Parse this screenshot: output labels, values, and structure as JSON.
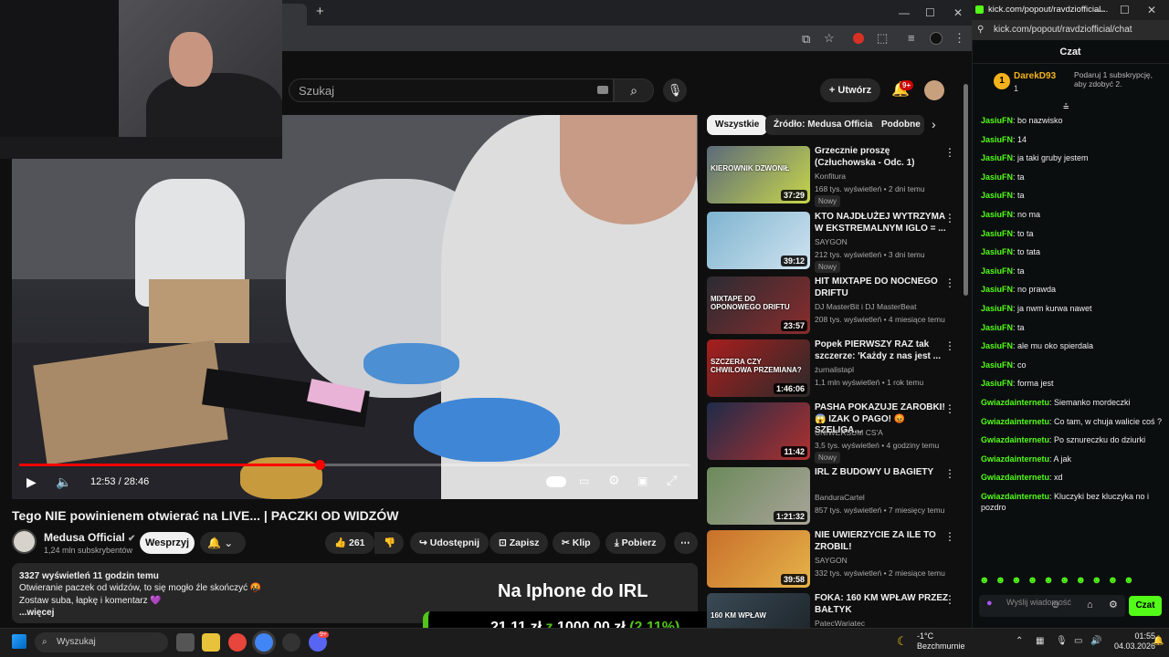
{
  "browser": {
    "new_tab": "+",
    "window_controls": [
      "—",
      "☐",
      "✕"
    ]
  },
  "youtube": {
    "search_placeholder": "Szukaj",
    "create_label": "Utwórz",
    "notif_count": "9+",
    "video": {
      "time": "12:53 / 28:46",
      "progress": 0.448,
      "title": "Tego NIE powinienem otwierać na LIVE... | PACZKI OD WIDZÓW",
      "channel": "Medusa Official",
      "subs": "1,24 mln subskrybentów",
      "support_label": "Wesprzyj",
      "likes": "261",
      "share_label": "Udostępnij",
      "save_label": "Zapisz",
      "clip_label": "Klip",
      "download_label": "Pobierz",
      "views_line": "3327 wyświetleń  11 godzin temu",
      "desc1": "Otwieranie paczek od widzów, to się mogło źle skończyć 🤬",
      "desc2": "Zostaw suba, łapkę i komentarz 💜",
      "more": "...więcej"
    },
    "overlay": {
      "line1": "Na Iphone do IRL",
      "amount": "21,11 zł",
      "z": "z",
      "goal": "1000,00 zł",
      "pct": "(2.11%)"
    },
    "chips": [
      "Wszystkie",
      "Źródło: Medusa Official",
      "Podobne"
    ],
    "recs": [
      {
        "title": "Grzecznie proszę (Człuchowska - Odc. 1)",
        "channel": "Konfitura",
        "meta": "168 tys. wyświetleń • 2 dni temu",
        "dur": "37:29",
        "new": "Nowy",
        "thumb_label": "KIEROWNIK DZWONIŁ",
        "c1": "#5b6a7a",
        "c2": "#c7d64a"
      },
      {
        "title": "KTO NAJDŁUŻEJ WYTRZYMA W EKSTREMALNYM IGLO = ...",
        "channel": "SAYGON",
        "meta": "212 tys. wyświetleń • 3 dni temu",
        "dur": "39:12",
        "new": "Nowy",
        "thumb_label": "",
        "c1": "#7fb4d0",
        "c2": "#cfe3ef"
      },
      {
        "title": "HIT MIXTAPE DO NOCNEGO DRIFTU",
        "channel": "DJ MasterBit i DJ MasterBeat",
        "meta": "208 tys. wyświetleń • 4 miesiące temu",
        "dur": "23:57",
        "new": "",
        "thumb_label": "MIXTAPE DO OPONOWEGO DRIFTU",
        "c1": "#2a2c33",
        "c2": "#8a2c2c"
      },
      {
        "title": "Popek PIERWSZY RAZ tak szczerze: 'Każdy z nas jest ...",
        "channel": "żurnalistapl",
        "meta": "1,1 mln wyświetleń • 1 rok temu",
        "dur": "1:46:06",
        "new": "",
        "thumb_label": "SZCZERA CZY CHWILOWA PRZEMIANA?",
        "c1": "#a81e1e",
        "c2": "#2a2a2a"
      },
      {
        "title": "PASHA POKAZUJE ZAROBKI! 😱 IZAK O PAGO! 😡 SZELIGA...",
        "channel": "UNIWERSUM CS'A",
        "meta": "3,5 tys. wyświetleń • 4 godziny temu",
        "dur": "11:42",
        "new": "Nowy",
        "thumb_label": "",
        "c1": "#1e2c4a",
        "c2": "#b0302e"
      },
      {
        "title": "IRL Z BUDOWY U BAGIETY",
        "channel": "BandurаCartel",
        "meta": "857 tys. wyświetleń • 7 miesięcy temu",
        "dur": "1:21:32",
        "new": "",
        "thumb_label": "",
        "c1": "#6b8a5a",
        "c2": "#a9a49a"
      },
      {
        "title": "NIE UWIERZYCIE ZA ILE TO ZROBIL!",
        "channel": "SAYGON",
        "meta": "332 tys. wyświetleń • 2 miesiące temu",
        "dur": "39:58",
        "new": "",
        "thumb_label": "",
        "c1": "#c8702a",
        "c2": "#e6b34a"
      },
      {
        "title": "FOKA: 160 KM WPŁAW PRZEZ BAŁTYK",
        "channel": "PatecWariatec",
        "meta": "",
        "dur": "",
        "new": "",
        "thumb_label": "160 KM WPŁAW",
        "c1": "#3a4a55",
        "c2": "#1b2228"
      }
    ]
  },
  "kick": {
    "title": "kick.com/popout/ravdziofficial...",
    "url": "kick.com/popout/ravdziofficial/chat",
    "header": "Czat",
    "gift": {
      "rank": "1",
      "user": "DarekD93",
      "count": "1",
      "msg": "Podaruj 1 subskrypcję, aby zdobyć 2."
    },
    "messages": [
      {
        "u": "JasiuFN",
        "t": "bo nazwisko"
      },
      {
        "u": "JasiuFN",
        "t": "14"
      },
      {
        "u": "JasiuFN",
        "t": "ja taki gruby jestem"
      },
      {
        "u": "JasiuFN",
        "t": "ta"
      },
      {
        "u": "JasiuFN",
        "t": "ta"
      },
      {
        "u": "JasiuFN",
        "t": "no ma"
      },
      {
        "u": "JasiuFN",
        "t": "to ta"
      },
      {
        "u": "JasiuFN",
        "t": "to tata"
      },
      {
        "u": "JasiuFN",
        "t": "ta"
      },
      {
        "u": "JasiuFN",
        "t": "no prawda"
      },
      {
        "u": "JasiuFN",
        "t": "ja nwm kurwa nawet"
      },
      {
        "u": "JasiuFN",
        "t": "ta"
      },
      {
        "u": "JasiuFN",
        "t": "ale mu oko spierdala"
      },
      {
        "u": "JasiuFN",
        "t": "co"
      },
      {
        "u": "JasiuFN",
        "t": "forma jest"
      },
      {
        "u": "Gwiazdainternetu",
        "t": "Siemanko mordeczki"
      },
      {
        "u": "Gwiazdainternetu",
        "t": "Co tam, w chuja walicie coś ?"
      },
      {
        "u": "Gwiazdainternetu",
        "t": "Po sznureczku do dziurki"
      },
      {
        "u": "Gwiazdainternetu",
        "t": "A jak"
      },
      {
        "u": "Gwiazdainternetu",
        "t": "xd"
      },
      {
        "u": "Gwiazdainternetu",
        "t": "Kluczyki bez kluczyka no i pozdro"
      }
    ],
    "input_placeholder": "Wyślij wiadomość",
    "send_label": "Czat"
  },
  "taskbar": {
    "search": "Wyszukaj",
    "temp": "-1°C",
    "weather": "Bezchmurnie",
    "time": "01:55",
    "date": "04.03.2026",
    "discord_badge": "9+"
  }
}
